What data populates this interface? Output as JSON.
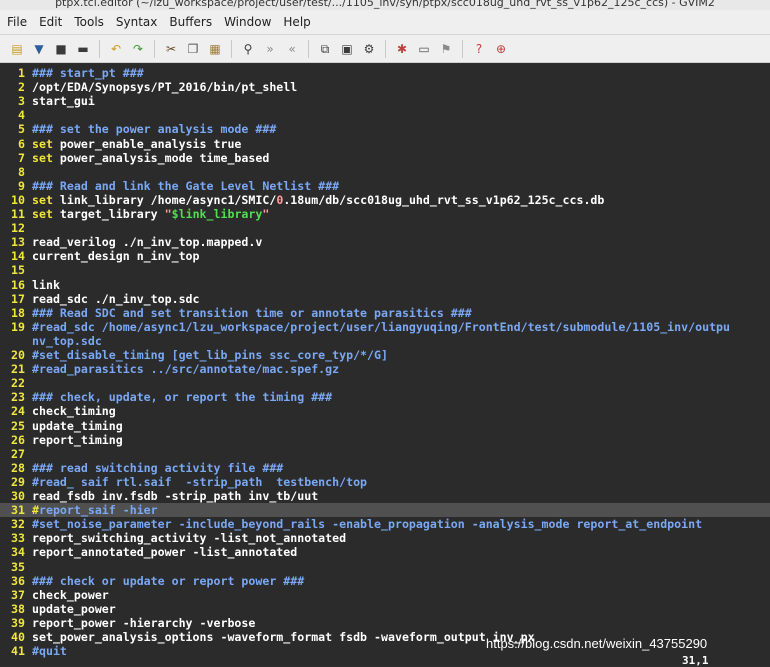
{
  "window": {
    "title": "ptpx.tcl.editor (~/lzu_workspace/project/user/test/.../1105_inv/syn/ptpx/scc018ug_uhd_rvt_ss_v1p62_125c_ccs) - GVIM2"
  },
  "menu": [
    "File",
    "Edit",
    "Tools",
    "Syntax",
    "Buffers",
    "Window",
    "Help"
  ],
  "toolbar": [
    {
      "icon": "open-file-icon",
      "color": "#c79a2b",
      "glyph": "▤"
    },
    {
      "icon": "save-icon",
      "color": "#2c5e9e",
      "glyph": "▼"
    },
    {
      "icon": "save-all-icon",
      "color": "#3b3b3b",
      "glyph": "■"
    },
    {
      "icon": "print-icon",
      "color": "#3b3b3b",
      "glyph": "▬"
    },
    {
      "sep": true
    },
    {
      "icon": "undo-icon",
      "color": "#d49a1e",
      "glyph": "↶"
    },
    {
      "icon": "redo-icon",
      "color": "#3a9a2a",
      "glyph": "↷"
    },
    {
      "sep": true
    },
    {
      "icon": "cut-icon",
      "color": "#6b4b2b",
      "glyph": "✂"
    },
    {
      "icon": "copy-icon",
      "color": "#555555",
      "glyph": "❐"
    },
    {
      "icon": "paste-icon",
      "color": "#a07a3a",
      "glyph": "▦"
    },
    {
      "sep": true
    },
    {
      "icon": "find-replace-icon",
      "color": "#3b3b3b",
      "glyph": "⚲"
    },
    {
      "icon": "find-next-icon",
      "color": "#8a8a8a",
      "glyph": "»"
    },
    {
      "icon": "find-prev-icon",
      "color": "#8a8a8a",
      "glyph": "«"
    },
    {
      "sep": true
    },
    {
      "icon": "load-session-icon",
      "color": "#3b3b3b",
      "glyph": "⧉"
    },
    {
      "icon": "save-session-icon",
      "color": "#3b3b3b",
      "glyph": "▣"
    },
    {
      "icon": "run-script-icon",
      "color": "#3b3b3b",
      "glyph": "⚙"
    },
    {
      "sep": true
    },
    {
      "icon": "make-icon",
      "color": "#c04040",
      "glyph": "✱"
    },
    {
      "icon": "shell-icon",
      "color": "#555555",
      "glyph": "▭"
    },
    {
      "icon": "ctags-icon",
      "color": "#8a8a8a",
      "glyph": "⚑"
    },
    {
      "sep": true
    },
    {
      "icon": "help-icon",
      "color": "#c04040",
      "glyph": "?"
    },
    {
      "icon": "find-help-icon",
      "color": "#c04040",
      "glyph": "⊕"
    }
  ],
  "editor": {
    "current_line": 31,
    "lines": [
      {
        "n": "1",
        "segs": [
          [
            "comment",
            "### start_pt ###"
          ]
        ]
      },
      {
        "n": "2",
        "segs": [
          [
            "text",
            "/opt/EDA/Synopsys/PT_2016/bin/pt_shell"
          ]
        ]
      },
      {
        "n": "3",
        "segs": [
          [
            "text",
            "start_gui"
          ]
        ]
      },
      {
        "n": "4",
        "segs": []
      },
      {
        "n": "5",
        "segs": [
          [
            "comment",
            "### set the power analysis mode ###"
          ]
        ]
      },
      {
        "n": "6",
        "segs": [
          [
            "keyword",
            "set"
          ],
          [
            "text",
            " power_enable_analysis true"
          ]
        ]
      },
      {
        "n": "7",
        "segs": [
          [
            "keyword",
            "set"
          ],
          [
            "text",
            " power_analysis_mode time_based"
          ]
        ]
      },
      {
        "n": "8",
        "segs": []
      },
      {
        "n": "9",
        "segs": [
          [
            "comment",
            "### Read and link the Gate Level Netlist ###"
          ]
        ]
      },
      {
        "n": "10",
        "segs": [
          [
            "keyword",
            "set"
          ],
          [
            "text",
            " link_library /home/async1/SMIC/"
          ],
          [
            "number",
            "0"
          ],
          [
            "text",
            ".18um/db/scc018ug_uhd_rvt_ss_v1p62_125c_ccs.db"
          ]
        ]
      },
      {
        "n": "11",
        "segs": [
          [
            "keyword",
            "set"
          ],
          [
            "text",
            " target_library "
          ],
          [
            "number",
            "\""
          ],
          [
            "string",
            "$link_library"
          ],
          [
            "number",
            "\""
          ]
        ]
      },
      {
        "n": "12",
        "segs": []
      },
      {
        "n": "13",
        "segs": [
          [
            "text",
            "read_verilog ./n_inv_top.mapped.v"
          ]
        ]
      },
      {
        "n": "14",
        "segs": [
          [
            "text",
            "current_design n_inv_top"
          ]
        ]
      },
      {
        "n": "15",
        "segs": []
      },
      {
        "n": "16",
        "segs": [
          [
            "text",
            "link"
          ]
        ]
      },
      {
        "n": "17",
        "segs": [
          [
            "text",
            "read_sdc ./n_inv_top.sdc"
          ]
        ]
      },
      {
        "n": "18",
        "segs": [
          [
            "comment",
            "### Read SDC and set transition time or annotate parasitics ###"
          ]
        ]
      },
      {
        "n": "19",
        "segs": [
          [
            "comment",
            "#read_sdc /home/async1/lzu_workspace/project/user/liangyuqing/FrontEnd/test/submodule/1105_inv/outpu"
          ]
        ]
      },
      {
        "n": "",
        "segs": [
          [
            "comment",
            "nv_top.sdc"
          ]
        ]
      },
      {
        "n": "20",
        "segs": [
          [
            "comment",
            "#set_disable_timing [get_lib_pins ssc_core_typ/*/G]"
          ]
        ]
      },
      {
        "n": "21",
        "segs": [
          [
            "comment",
            "#read_parasitics ../src/annotate/mac.spef.gz"
          ]
        ]
      },
      {
        "n": "22",
        "segs": []
      },
      {
        "n": "23",
        "segs": [
          [
            "comment",
            "### check, update, or report the timing ###"
          ]
        ]
      },
      {
        "n": "24",
        "segs": [
          [
            "text",
            "check_timing"
          ]
        ]
      },
      {
        "n": "25",
        "segs": [
          [
            "text",
            "update_timing"
          ]
        ]
      },
      {
        "n": "26",
        "segs": [
          [
            "text",
            "report_timing"
          ]
        ]
      },
      {
        "n": "27",
        "segs": []
      },
      {
        "n": "28",
        "segs": [
          [
            "comment",
            "### read switching activity file ###"
          ]
        ]
      },
      {
        "n": "29",
        "segs": [
          [
            "comment",
            "#read_ saif rtl.saif  -strip_path  testbench/top"
          ]
        ]
      },
      {
        "n": "30",
        "segs": [
          [
            "text",
            "read_fsdb inv.fsdb -strip_path inv_tb/uut"
          ]
        ]
      },
      {
        "n": "31",
        "segs": [
          [
            "keyword",
            "#"
          ],
          [
            "comment",
            "report_saif -hier"
          ]
        ]
      },
      {
        "n": "32",
        "segs": [
          [
            "comment",
            "#set_noise_parameter -include_beyond_rails -enable_propagation -analysis_mode report_at_endpoint"
          ]
        ]
      },
      {
        "n": "33",
        "segs": [
          [
            "text",
            "report_switching_activity -list_not_annotated"
          ]
        ]
      },
      {
        "n": "34",
        "segs": [
          [
            "text",
            "report_annotated_power -list_annotated"
          ]
        ]
      },
      {
        "n": "35",
        "segs": []
      },
      {
        "n": "36",
        "segs": [
          [
            "comment",
            "### check or update or report power ###"
          ]
        ]
      },
      {
        "n": "37",
        "segs": [
          [
            "text",
            "check_power"
          ]
        ]
      },
      {
        "n": "38",
        "segs": [
          [
            "text",
            "update_power"
          ]
        ]
      },
      {
        "n": "39",
        "segs": [
          [
            "text",
            "report_power -hierarchy -verbose"
          ]
        ]
      },
      {
        "n": "40",
        "segs": [
          [
            "text",
            "set_power_analysis_options -waveform_format fsdb -waveform_output inv_px"
          ]
        ]
      },
      {
        "n": "41",
        "segs": [
          [
            "comment",
            "#quit"
          ]
        ]
      }
    ]
  },
  "watermark": "https://blog.csdn.net/weixin_43755290",
  "ruler": "31,1"
}
